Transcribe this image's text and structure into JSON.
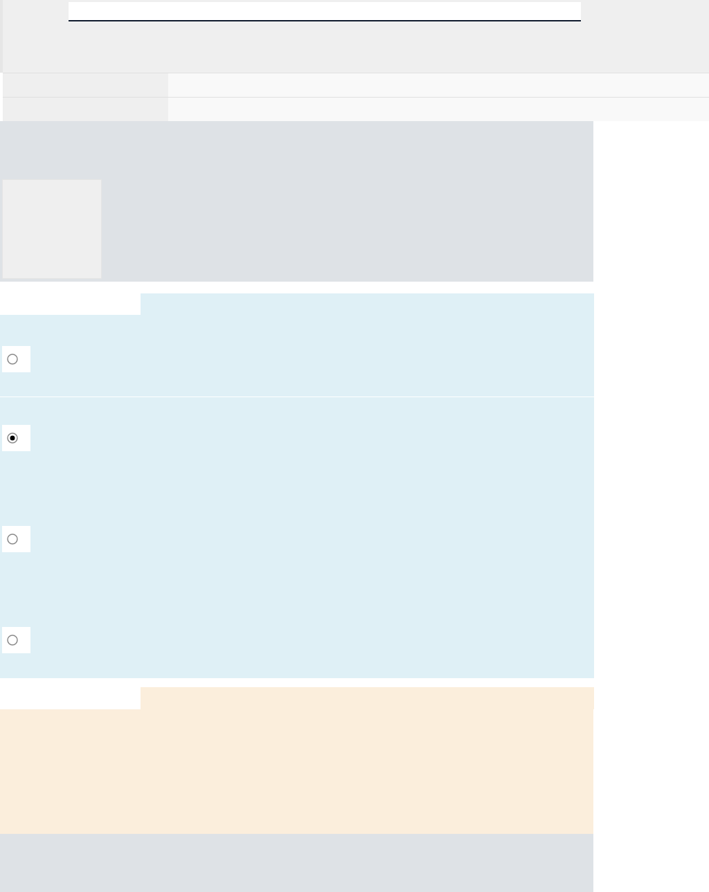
{
  "question": {
    "options": [
      {
        "selected": false
      },
      {
        "selected": true
      },
      {
        "selected": false
      },
      {
        "selected": false
      }
    ]
  }
}
